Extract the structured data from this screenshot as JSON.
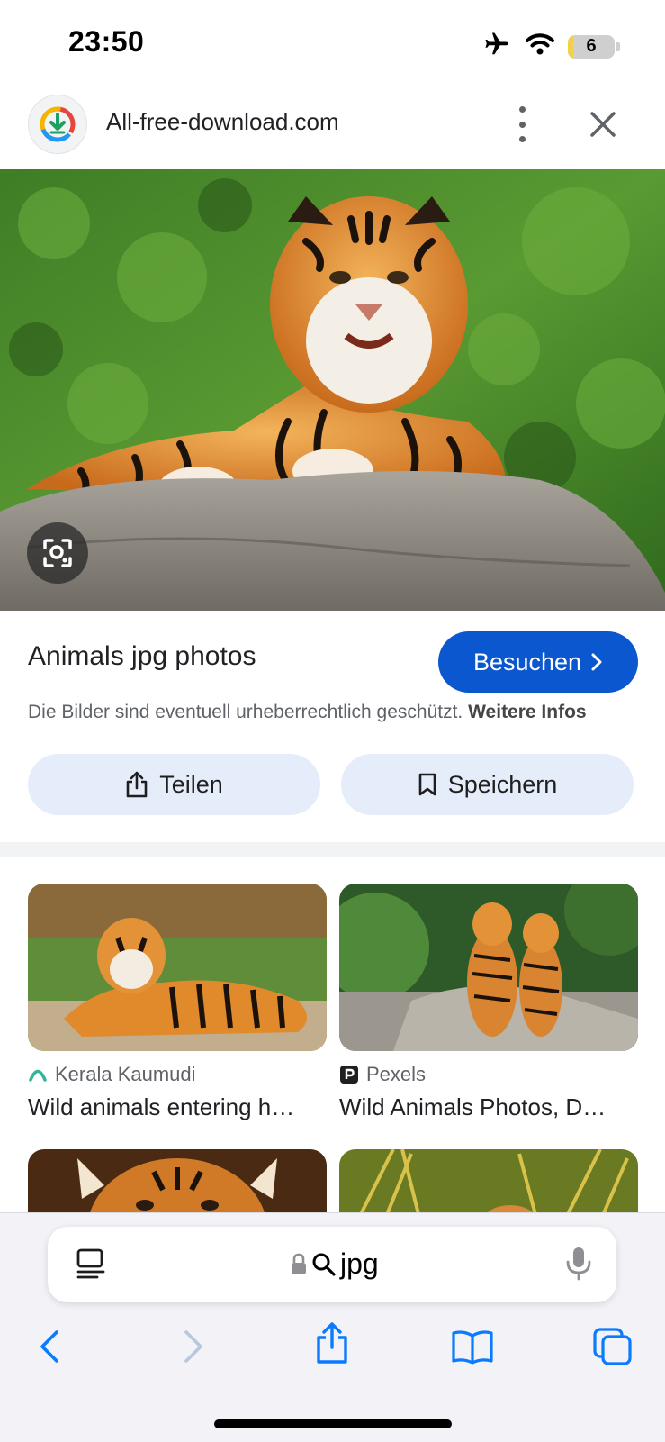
{
  "status_bar": {
    "time": "23:50",
    "battery_level": "6",
    "battery_fill_percent": 6,
    "icons": [
      "airplane-icon",
      "wifi-icon",
      "battery-icon"
    ]
  },
  "header": {
    "site_name": "All-free-download.com",
    "icons": [
      "favicon-download-icon",
      "more-vert-icon",
      "close-icon"
    ]
  },
  "preview": {
    "lens_icon": "lens-search-icon"
  },
  "info": {
    "title": "Animals jpg photos",
    "visit_label": "Besuchen",
    "copyright_text": "Die Bilder sind eventuell urheberrechtlich geschützt.",
    "more_info_label": "Weitere Infos"
  },
  "actions": {
    "share_label": "Teilen",
    "save_label": "Speichern"
  },
  "results": [
    {
      "source": "Kerala Kaumudi",
      "title": "Wild animals entering h…"
    },
    {
      "source": "Pexels",
      "title": "Wild Animals Photos, D…"
    }
  ],
  "browser": {
    "url_text": "jpg",
    "icons": [
      "reader-icon",
      "lock-icon",
      "search-icon",
      "microphone-icon",
      "back-icon",
      "forward-icon",
      "share-icon",
      "bookmarks-icon",
      "tabs-icon"
    ]
  },
  "colors": {
    "accent": "#0b57d0",
    "pill_bg": "#e5edfa",
    "toolbar_blue": "#0a7aff"
  }
}
